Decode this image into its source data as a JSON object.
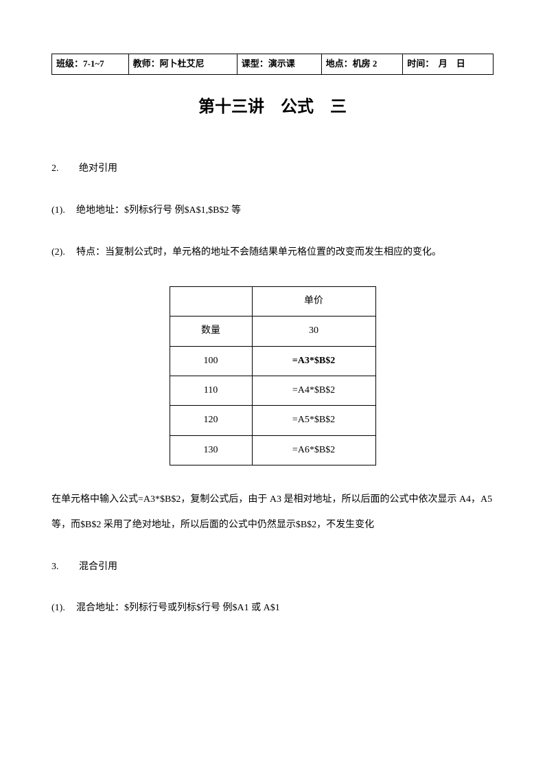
{
  "header": {
    "class_label": "班级：",
    "class_value": "7-1~7",
    "teacher_label": "教师：",
    "teacher_value": "阿卜杜艾尼",
    "type_label": "课型：",
    "type_value": "演示课",
    "location_label": "地点：",
    "location_value": "机房 2",
    "time_label": "时间：",
    "time_value": "　月　日"
  },
  "title": "第十三讲　公式　三",
  "section2": {
    "num": "2.",
    "heading": "绝对引用",
    "sub1_num": "(1).",
    "sub1_text": "绝地地址：$列标$行号  例$A$1,$B$2 等",
    "sub2_num": "(2).",
    "sub2_text": "特点：当复制公式时，单元格的地址不会随结果单元格位置的改变而发生相应的变化。"
  },
  "table": {
    "rows": [
      {
        "col1": "",
        "col2": "单价",
        "bold": false
      },
      {
        "col1": "数量",
        "col2": "30",
        "bold": false
      },
      {
        "col1": "100",
        "col2": "=A3*$B$2",
        "bold": true
      },
      {
        "col1": "110",
        "col2": "=A4*$B$2",
        "bold": false
      },
      {
        "col1": "120",
        "col2": "=A5*$B$2",
        "bold": false
      },
      {
        "col1": "130",
        "col2": "=A6*$B$2",
        "bold": false
      }
    ]
  },
  "paragraph": "在单元格中输入公式=A3*$B$2，复制公式后，由于 A3 是相对地址，所以后面的公式中依次显示 A4，A5 等，而$B$2 采用了绝对地址，所以后面的公式中仍然显示$B$2，不发生变化",
  "section3": {
    "num": "3.",
    "heading": "混合引用",
    "sub1_num": "(1).",
    "sub1_text": "混合地址：$列标行号或列标$行号  例$A1 或 A$1"
  }
}
